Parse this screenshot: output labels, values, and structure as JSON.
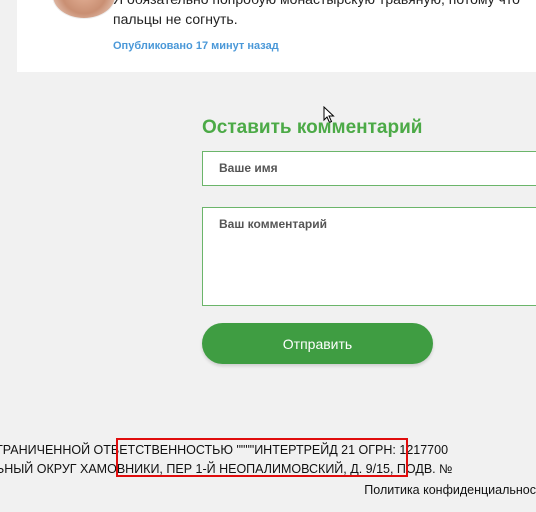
{
  "comment": {
    "text_line1": "Я обязательно попробую монастырскую травяную, потому что",
    "text_line2": "пальцы не согнуть.",
    "meta": "Опубликовано 17 минут назад"
  },
  "form": {
    "title": "Оставить комментарий",
    "name_placeholder": "Ваше имя",
    "comment_placeholder": "Ваш комментарий",
    "submit_label": "Отправить"
  },
  "footer": {
    "line1": "ГРАНИЧЕННОЙ ОТВЕТСТВЕННОСТЬЮ \"\"\"\"ИНТЕРТРЕЙД 21 ОГРН: 1217700",
    "line2": "ЬНЫЙ ОКРУГ ХАМОВНИКИ, ПЕР 1-Й НЕОПАЛИМОВСКИЙ, Д. 9/15, ПОДВ. №",
    "policy_link": "Политика конфиденциальнос"
  },
  "colors": {
    "accent_green": "#4caa47",
    "button_green": "#3f9d42",
    "link_blue": "#4a98d8",
    "highlight_red": "#e00d0d"
  }
}
